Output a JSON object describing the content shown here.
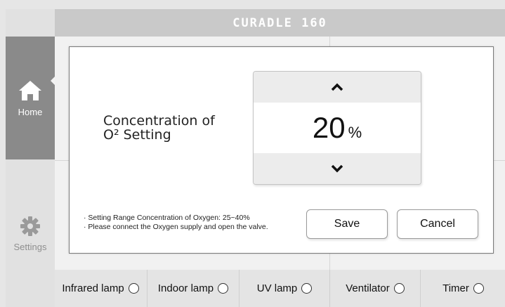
{
  "header": {
    "title": "CURADLE 160"
  },
  "sidebar": {
    "items": [
      {
        "label": "Home",
        "icon": "home-icon",
        "active": true
      },
      {
        "label": "Settings",
        "icon": "gear-icon",
        "active": false
      }
    ]
  },
  "dialog": {
    "title_line1": "Concentration of",
    "title_line2": "O² Setting",
    "value": "20",
    "unit": "%",
    "notes": [
      "· Setting Range Concentration of Oxygen: 25~40%",
      "· Please connect the Oxygen supply and open the valve."
    ],
    "save_label": "Save",
    "cancel_label": "Cancel"
  },
  "toggles": [
    {
      "label": "Infrared lamp",
      "on": false
    },
    {
      "label": "Indoor lamp",
      "on": false
    },
    {
      "label": "UV lamp",
      "on": false
    },
    {
      "label": "Ventilator",
      "on": false
    },
    {
      "label": "Timer",
      "on": false
    }
  ],
  "colors": {
    "header": "#c9c9c9",
    "sidebar_active": "#8a8a8a"
  }
}
